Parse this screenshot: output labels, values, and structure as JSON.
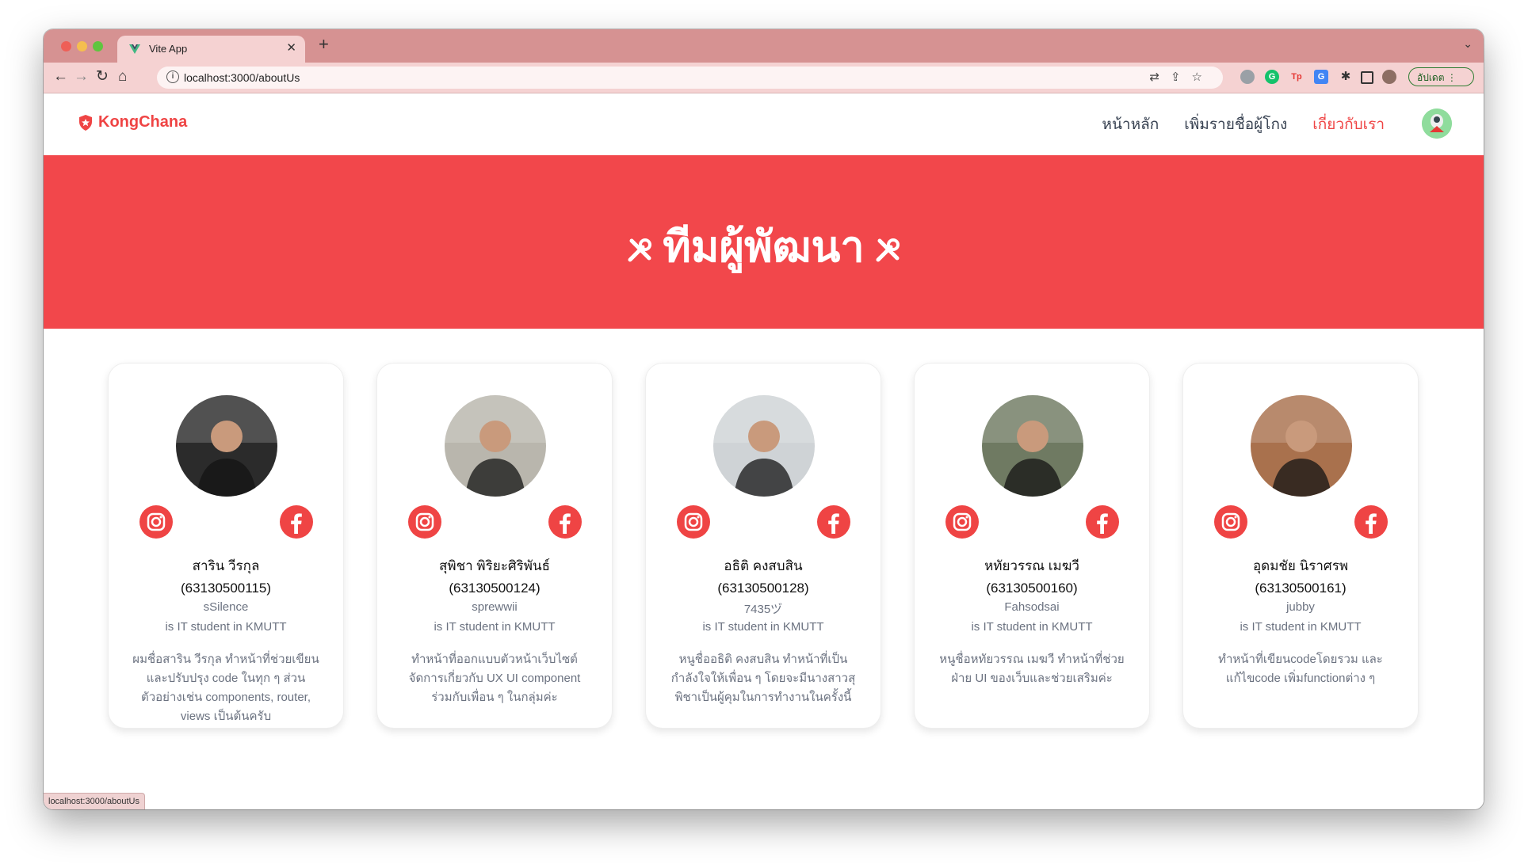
{
  "browser": {
    "tab_title": "Vite App",
    "url": "localhost:3000/aboutUs",
    "update_label": "อัปเดต",
    "status_url": "localhost:3000/aboutUs"
  },
  "site": {
    "brand": "KongChana",
    "menu": [
      {
        "label": "หน้าหลัก",
        "active": false
      },
      {
        "label": "เพิ่มรายชื่อผู้โกง",
        "active": false
      },
      {
        "label": "เกี่ยวกับเรา",
        "active": true
      }
    ]
  },
  "hero": {
    "title": "ทีมผู้พัฒนา"
  },
  "members": [
    {
      "name": "สาริน วีรกุล",
      "student_id": "(63130500115)",
      "nickname": "sSilence",
      "role": "is IT student in KMUTT",
      "description": "ผมชื่อสาริน วีรกุล ทำหน้าที่ช่วยเขียนและปรับปรุง code ในทุก ๆ ส่วน ตัวอย่างเช่น components, router, views เป็นต้นครับ",
      "photo_color": "#2b2b2b"
    },
    {
      "name": "สุพิชา พิริยะศิริพันธ์",
      "student_id": "(63130500124)",
      "nickname": "sprewwii",
      "role": "is IT student in KMUTT",
      "description": "ทำหน้าที่ออกแบบตัวหน้าเว็บไซต์ จัดการเกี่ยวกับ UX UI component ร่วมกับเพื่อน ๆ ในกลุ่มค่ะ",
      "photo_color": "#b9b6ad"
    },
    {
      "name": "อธิติ คงสบสิน",
      "student_id": "(63130500128)",
      "nickname": "7435ヅ",
      "role": "is IT student in KMUTT",
      "description": "หนูชื่ออธิติ คงสบสิน ทำหน้าที่เป็นกำลังใจให้เพื่อน ๆ โดยจะมีนางสาวสุพิชาเป็นผู้คุมในการทำงานในครั้งนี้",
      "photo_color": "#cfd3d6"
    },
    {
      "name": "หทัยวรรณ เมฆวี",
      "student_id": "(63130500160)",
      "nickname": "Fahsodsai",
      "role": "is IT student in KMUTT",
      "description": "หนูชื่อหทัยวรรณ เมฆวี ทำหน้าที่ช่วยฝ่าย UI ของเว็บและช่วยเสริมค่ะ",
      "photo_color": "#6f7a62"
    },
    {
      "name": "อุดมชัย นิราศรพ",
      "student_id": "(63130500161)",
      "nickname": "jubby",
      "role": "is IT student in KMUTT",
      "description": "ทำหน้าที่เขียนcodeโดยรวม และแก้ไขcode เพิ่มfunctionต่าง ๆ",
      "photo_color": "#a9714d"
    }
  ],
  "colors": {
    "accent": "#ef4444",
    "hero": "#f2474b",
    "chrome": "#d69292"
  }
}
